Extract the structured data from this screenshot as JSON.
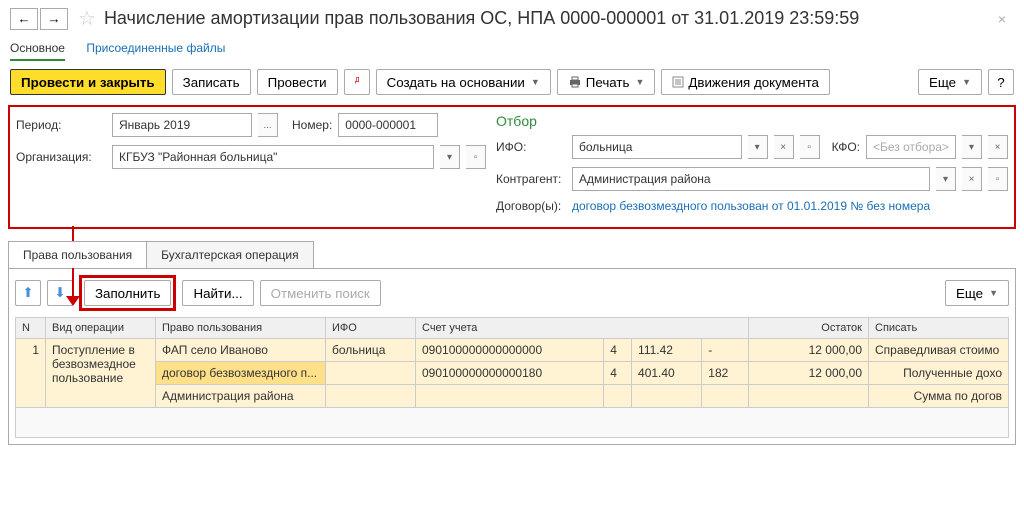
{
  "header": {
    "title": "Начисление амортизации прав пользования ОС, НПА 0000-000001 от 31.01.2019 23:59:59"
  },
  "nav": {
    "main": "Основное",
    "files": "Присоединенные файлы"
  },
  "toolbar": {
    "post_close": "Провести и закрыть",
    "save": "Записать",
    "post": "Провести",
    "create_based": "Создать на основании",
    "print": "Печать",
    "movements": "Движения документа",
    "more": "Еще",
    "help": "?"
  },
  "form": {
    "period_label": "Период:",
    "period_value": "Январь 2019",
    "number_label": "Номер:",
    "number_value": "0000-000001",
    "org_label": "Организация:",
    "org_value": "КГБУЗ \"Районная больница\""
  },
  "filter": {
    "title": "Отбор",
    "ifo_label": "ИФО:",
    "ifo_value": "больница",
    "kfo_label": "КФО:",
    "kfo_placeholder": "<Без отбора>",
    "contr_label": "Контрагент:",
    "contr_value": "Администрация  района",
    "contracts_label": "Договор(ы):",
    "contracts_value": "договор безвозмездного пользован от 01.01.2019 № без номера"
  },
  "tabs": {
    "tab1": "Права пользования",
    "tab2": "Бухгалтерская операция"
  },
  "sub_toolbar": {
    "fill": "Заполнить",
    "find": "Найти...",
    "cancel_search": "Отменить поиск",
    "more": "Еще"
  },
  "table": {
    "headers": {
      "n": "N",
      "op_type": "Вид операции",
      "right": "Право пользования",
      "ifo": "ИФО",
      "account": "Счет учета",
      "balance": "Остаток",
      "writeoff": "Списать"
    },
    "rows": [
      {
        "n": "1",
        "op_type": "Поступление в безвозмездное пользование",
        "right": "ФАП село Иваново",
        "ifo": "больница",
        "acc1": "090100000000000000",
        "acc2": "4",
        "acc3": "111.42",
        "acc4": "-",
        "balance": "12 000,00",
        "writeoff": "Справедливая стоимо"
      },
      {
        "right": "договор безвозмездного п...",
        "acc1": "090100000000000180",
        "acc2": "4",
        "acc3": "401.40",
        "acc4": "182",
        "balance": "12 000,00",
        "writeoff": "Полученные дохо"
      },
      {
        "right": "Администрация  района",
        "writeoff": "Сумма по догов"
      }
    ]
  }
}
